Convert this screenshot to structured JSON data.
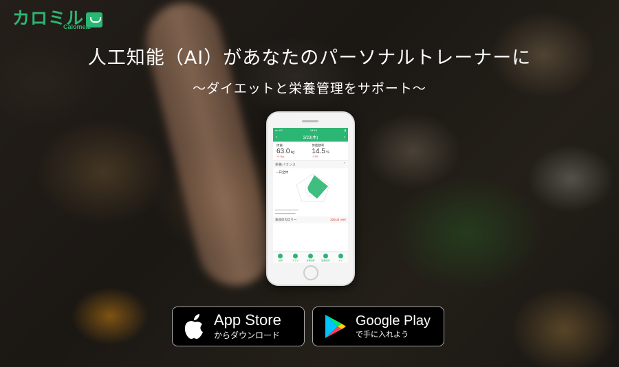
{
  "brand": {
    "logo_text": "カロミル",
    "logo_subtext": "Calomeal",
    "color": "#2bb673"
  },
  "hero": {
    "headline": "人工知能（AI）があなたのパーソナルトレーナーに",
    "subheadline": "〜ダイエットと栄養管理をサポート〜"
  },
  "phone_screen": {
    "status_left": "au 4G",
    "status_time": "18:18",
    "date_label": "3/23(木)",
    "nav_prev_icon": "chevron-left-icon",
    "nav_next_icon": "chevron-right-icon",
    "weight_label": "体重",
    "weight_value": "63.0",
    "weight_unit": "kg",
    "weight_diff": "+0.1kg",
    "bodyfat_label": "体脂肪率",
    "bodyfat_value": "14.5",
    "bodyfat_unit": "%",
    "bodyfat_diff": "-2.5%",
    "nutrition_section": "栄養バランス",
    "radar_selector": "一日全体",
    "calorie_section": "本日のカロリー",
    "calorie_status": "32kcal over",
    "tabs": [
      "記録",
      "グラフ",
      "食事記録",
      "健康記録",
      "マイ"
    ]
  },
  "stores": {
    "apple": {
      "title": "App Store",
      "subtitle": "からダウンロード",
      "icon": "apple-icon"
    },
    "google": {
      "title": "Google Play",
      "subtitle": "で手に入れよう",
      "icon": "google-play-icon"
    }
  }
}
